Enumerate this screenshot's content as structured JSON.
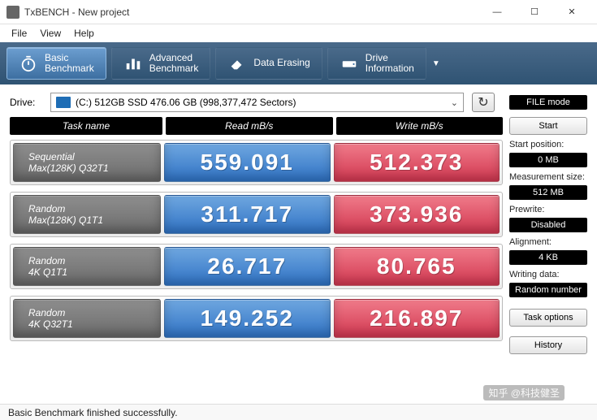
{
  "window": {
    "title": "TxBENCH - New project",
    "minimize": "—",
    "maximize": "☐",
    "close": "✕"
  },
  "menu": {
    "file": "File",
    "view": "View",
    "help": "Help"
  },
  "nav": {
    "basic": {
      "l1": "Basic",
      "l2": "Benchmark"
    },
    "advanced": {
      "l1": "Advanced",
      "l2": "Benchmark"
    },
    "erase": {
      "l1": "Data Erasing"
    },
    "drive": {
      "l1": "Drive",
      "l2": "Information"
    },
    "arrow": "▼"
  },
  "drive": {
    "label": "Drive:",
    "text": "(C:) 512GB SSD  476.06 GB (998,377,472 Sectors)",
    "chevron": "⌄",
    "refresh": "↻"
  },
  "sidebar": {
    "filemode": "FILE mode",
    "start": "Start",
    "startpos_label": "Start position:",
    "startpos": "0 MB",
    "meassize_label": "Measurement size:",
    "meassize": "512 MB",
    "prewrite_label": "Prewrite:",
    "prewrite": "Disabled",
    "alignment_label": "Alignment:",
    "alignment": "4 KB",
    "writedata_label": "Writing data:",
    "writedata": "Random number",
    "taskoptions": "Task options",
    "history": "History"
  },
  "table": {
    "head_name": "Task name",
    "head_read": "Read mB/s",
    "head_write": "Write mB/s",
    "rows": [
      {
        "name1": "Sequential",
        "name2": "Max(128K) Q32T1",
        "read": "559.091",
        "write": "512.373"
      },
      {
        "name1": "Random",
        "name2": "Max(128K) Q1T1",
        "read": "311.717",
        "write": "373.936"
      },
      {
        "name1": "Random",
        "name2": "4K Q1T1",
        "read": "26.717",
        "write": "80.765"
      },
      {
        "name1": "Random",
        "name2": "4K Q32T1",
        "read": "149.252",
        "write": "216.897"
      }
    ]
  },
  "status": "Basic Benchmark finished successfully.",
  "watermark": "知乎 @科技健圣"
}
